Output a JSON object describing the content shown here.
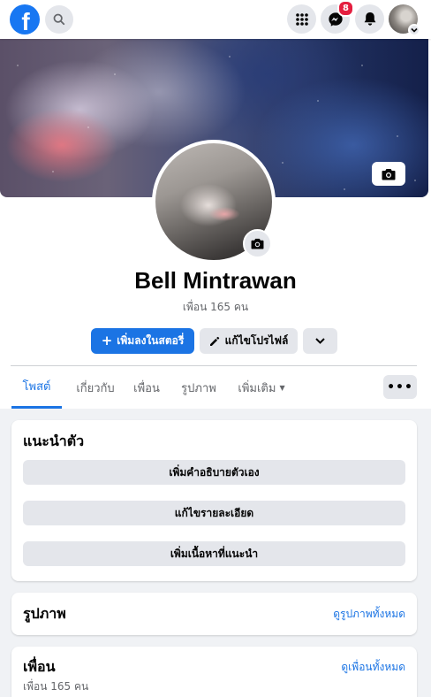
{
  "topbar": {
    "logo_letter": "f",
    "messenger_badge": "8",
    "icons": {
      "search": "search-icon",
      "menu": "grid-menu-icon",
      "messenger": "messenger-icon",
      "notifications": "bell-icon",
      "account": "chevron-down-icon"
    }
  },
  "profile": {
    "name": "Bell Mintrawan",
    "friend_count_label": "เพื่อน 165 คน"
  },
  "actions": {
    "add_story": "เพิ่มลงในสตอรี่",
    "add_story_icon": "+",
    "edit_profile": "แก้ไขโปรไฟล์"
  },
  "tabs": {
    "posts": "โพสต์",
    "about": "เกี่ยวกับ",
    "friends": "เพื่อน",
    "photos": "รูปภาพ",
    "more": "เพิ่มเติม",
    "more_caret": "▼",
    "dots": "•••"
  },
  "intro": {
    "title": "แนะนำตัว",
    "add_bio": "เพิ่มคำอธิบายตัวเอง",
    "edit_details": "แก้ไขรายละเอียด",
    "add_featured": "เพิ่มเนื้อหาที่แนะนำ"
  },
  "photos_section": {
    "title": "รูปภาพ",
    "see_all": "ดูรูปภาพทั้งหมด"
  },
  "friends_section": {
    "title": "เพื่อน",
    "see_all": "ดูเพื่อนทั้งหมด",
    "count_label": "เพื่อน 165 คน"
  },
  "colors": {
    "brand_blue": "#1877f2",
    "button_blue": "#1b74e4",
    "badge_red": "#e41e3f",
    "secondary_button": "#e4e6eb",
    "page_bg": "#f0f2f5"
  }
}
